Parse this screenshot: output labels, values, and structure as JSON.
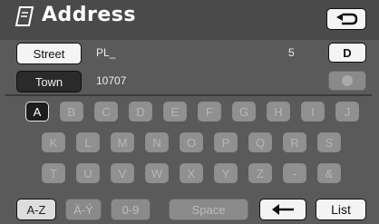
{
  "header": {
    "title": "Address",
    "icon": "address-book-icon",
    "back_icon": "u-turn-back-icon"
  },
  "fields": [
    {
      "label": "Street",
      "value": "PL_",
      "extra": "5",
      "active": true
    },
    {
      "label": "Town",
      "value": "10707",
      "active": false
    }
  ],
  "side_buttons": {
    "d_label": "D",
    "circle_icon": "circle-icon"
  },
  "keyboard": {
    "rows": [
      [
        "A",
        "B",
        "C",
        "D",
        "E",
        "F",
        "G",
        "H",
        "I",
        "J"
      ],
      [
        "K",
        "L",
        "M",
        "N",
        "O",
        "P",
        "Q",
        "R",
        "S"
      ],
      [
        "T",
        "U",
        "V",
        "W",
        "X",
        "Y",
        "Z",
        "-",
        "&"
      ]
    ],
    "active_key": "A"
  },
  "bottom": {
    "az_label": "A-Z",
    "ay_label": "Ä-Ý",
    "digits_label": "0-9",
    "space_label": "Space",
    "backspace_icon": "left-arrow-icon",
    "list_label": "List"
  },
  "colors": {
    "background": "#5a5a5a",
    "header": "#4a4a4a",
    "key_inactive": "#909090",
    "key_active": "#1d1d1d"
  }
}
